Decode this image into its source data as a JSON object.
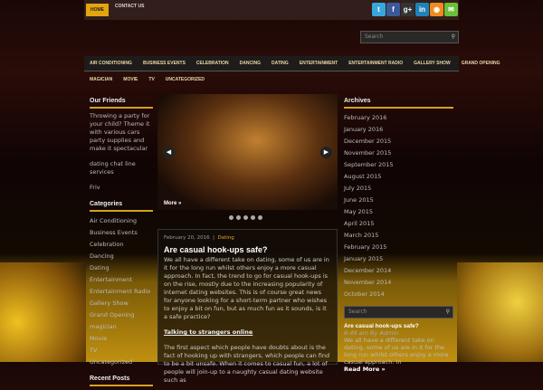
{
  "topbar": {
    "home": "HOME",
    "contact": "CONTACT US",
    "social": [
      {
        "icon": "twitter-icon",
        "glyph": "t",
        "color": "#3aa7dc"
      },
      {
        "icon": "facebook-icon",
        "glyph": "f",
        "color": "#3b5998"
      },
      {
        "icon": "google-plus-icon",
        "glyph": "g+",
        "color": "#333"
      },
      {
        "icon": "linkedin-icon",
        "glyph": "in",
        "color": "#1f83b8"
      },
      {
        "icon": "rss-icon",
        "glyph": "◉",
        "color": "#f08a20"
      },
      {
        "icon": "email-icon",
        "glyph": "✉",
        "color": "#6cbf3a"
      }
    ]
  },
  "header_search": {
    "placeholder": "Search"
  },
  "nav": {
    "row1": [
      "AIR CONDITIONING",
      "BUSINESS EVENTS",
      "CELEBRATION",
      "DANCING",
      "DATING",
      "ENTERTAINMENT",
      "ENTERTAINMENT RADIO",
      "GALLERY SHOW",
      "GRAND OPENING"
    ],
    "row2": [
      "MAGICIAN",
      "MOVIE",
      "TV",
      "UNCATEGORIZED"
    ]
  },
  "friends": {
    "title": "Our Friends",
    "text": "Throwing a party for your child? Theme it with various cars party supplies and make it spectacular",
    "links": [
      "dating chat line services",
      "Friv"
    ]
  },
  "categories": {
    "title": "Categories",
    "items": [
      "Air Conditioning",
      "Business Events",
      "Celebration",
      "Dancing",
      "Dating",
      "Entertainment",
      "Entertainment Radio",
      "Gallery Show",
      "Grand Opening",
      "magician",
      "Movie",
      "TV",
      "Uncategorized"
    ]
  },
  "recent_posts_title": "Recent Posts",
  "slider": {
    "more": "More »",
    "dots": 5
  },
  "post": {
    "date": "February 20, 2016",
    "category": "Dating",
    "title": "Are casual hook-ups safe?",
    "p1": "We all have a different take on dating, some of us are in it for the long run whilst others enjoy a more casual approach. In fact, the trend to go for casual hook-ups is on the rise, mostly due to the increasing popularity of internet dating websites. This is of course great news for anyone looking for a short-term partner who wishes to enjoy a bit on fun, but as much fun as it sounds, is it a safe practice?",
    "subheading": "Talking to strangers online",
    "p2": "The first aspect which people have doubts about is the fact of hooking up with strangers, which people can find to be a bit unsafe. When it comes to casual fun, a lot of people will join-up to a naughty casual dating website such as"
  },
  "archives": {
    "title": "Archives",
    "items": [
      "February 2016",
      "January 2016",
      "December 2015",
      "November 2015",
      "September 2015",
      "August 2015",
      "July 2015",
      "June 2015",
      "May 2015",
      "April 2015",
      "March 2015",
      "February 2015",
      "January 2015",
      "December 2014",
      "November 2014",
      "October 2014"
    ]
  },
  "sidebar_search": {
    "placeholder": "Search"
  },
  "recent": {
    "title": "Are casual hook-ups safe?",
    "time": "6:49 am By Admin",
    "excerpt": "We all have a different take on dating, some of us are in it for the long run whilst others enjoy a more casual approach. In",
    "read_more": "Read More »"
  }
}
